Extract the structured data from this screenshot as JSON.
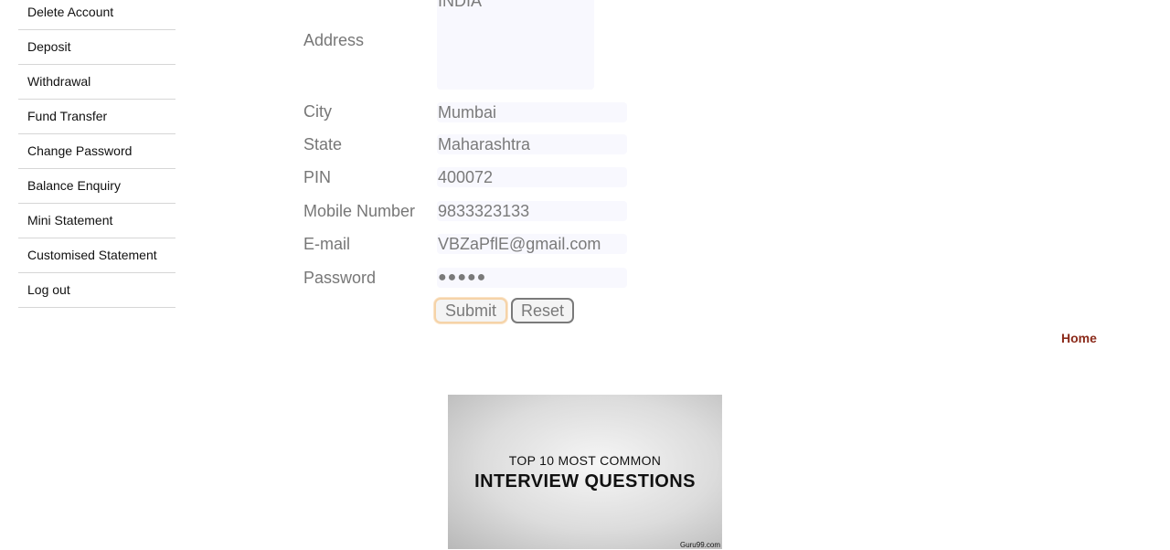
{
  "sidebar": {
    "items": [
      {
        "label": "Delete Account"
      },
      {
        "label": "Deposit"
      },
      {
        "label": "Withdrawal"
      },
      {
        "label": "Fund Transfer"
      },
      {
        "label": "Change Password"
      },
      {
        "label": "Balance Enquiry"
      },
      {
        "label": "Mini Statement"
      },
      {
        "label": "Customised Statement"
      },
      {
        "label": "Log out"
      }
    ]
  },
  "form": {
    "address": {
      "label": "Address",
      "value": "INDIA"
    },
    "city": {
      "label": "City",
      "value": "Mumbai"
    },
    "state": {
      "label": "State",
      "value": "Maharashtra"
    },
    "pin": {
      "label": "PIN",
      "value": "400072"
    },
    "mobile": {
      "label": "Mobile Number",
      "value": "9833323133"
    },
    "email": {
      "label": "E-mail",
      "value": "VBZaPflE@gmail.com"
    },
    "password": {
      "label": "Password",
      "value": "●●●●●"
    },
    "submit_label": "Submit",
    "reset_label": "Reset"
  },
  "home_link": "Home",
  "banner": {
    "line1": "TOP 10 MOST COMMON",
    "line2": "INTERVIEW QUESTIONS",
    "credit": "Guru99.com"
  }
}
